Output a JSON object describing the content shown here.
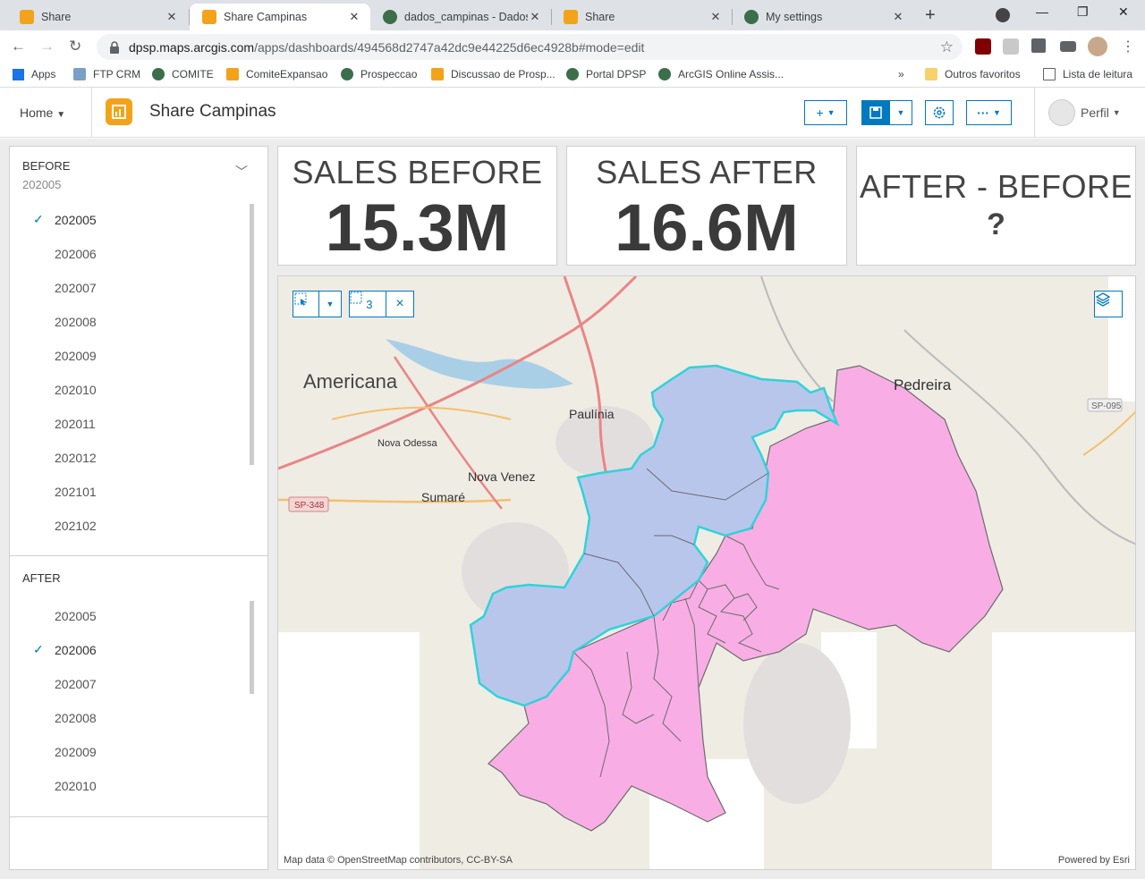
{
  "browser": {
    "tabs": [
      {
        "title": "Share",
        "active": false
      },
      {
        "title": "Share Campinas",
        "active": true
      },
      {
        "title": "dados_campinas - Dados",
        "active": false
      },
      {
        "title": "Share",
        "active": false
      },
      {
        "title": "My settings",
        "active": false
      }
    ],
    "url_host": "dpsp.maps.arcgis.com",
    "url_path": "/apps/dashboards/494568d2747a42dc9e44225d6ec4928b#mode=edit",
    "bookmarks": [
      "Apps",
      "FTP CRM",
      "COMITE",
      "ComiteExpansao",
      "Prospeccao",
      "Discussao de Prosp...",
      "Portal DPSP",
      "ArcGIS Online Assis..."
    ],
    "bookmarks_more": "»",
    "other_favorites": "Outros favoritos",
    "reading_list": "Lista de leitura"
  },
  "header": {
    "home_label": "Home",
    "title": "Share Campinas",
    "add_label": "+",
    "more_label": "···",
    "profile_label": "Perfil"
  },
  "selectors": {
    "before": {
      "label": "BEFORE",
      "current": "202005",
      "options": [
        "202005",
        "202006",
        "202007",
        "202008",
        "202009",
        "202010",
        "202011",
        "202012",
        "202101",
        "202102"
      ],
      "selected": "202005"
    },
    "after": {
      "label": "AFTER",
      "options": [
        "202005",
        "202006",
        "202007",
        "202008",
        "202009",
        "202010"
      ],
      "selected": "202006"
    }
  },
  "indicators": {
    "sales_before": {
      "title": "SALES BEFORE",
      "value": "15.3M"
    },
    "sales_after": {
      "title": "SALES AFTER",
      "value": "16.6M"
    },
    "diff": {
      "title": "AFTER - BEFORE",
      "value": "?"
    }
  },
  "map": {
    "selection_count": "3",
    "clear_label": "×",
    "place_labels": [
      "Americana",
      "Paulínia",
      "Pedreira",
      "Nova Odessa",
      "Sumaré",
      "Nova Venez",
      "SP-348",
      "SP-095"
    ],
    "attribution": "Map data © OpenStreetMap contributors, CC-BY-SA",
    "powered_by": "Powered by Esri",
    "colors": {
      "selected_fill": "#b9c6ec",
      "selected_stroke": "#2fd3d8",
      "region_fill": "#f8aee4",
      "region_stroke": "#6b6b6b",
      "base": "#efece4"
    }
  },
  "colors": {
    "accent": "#0079c1",
    "logo": "#f3a319"
  }
}
